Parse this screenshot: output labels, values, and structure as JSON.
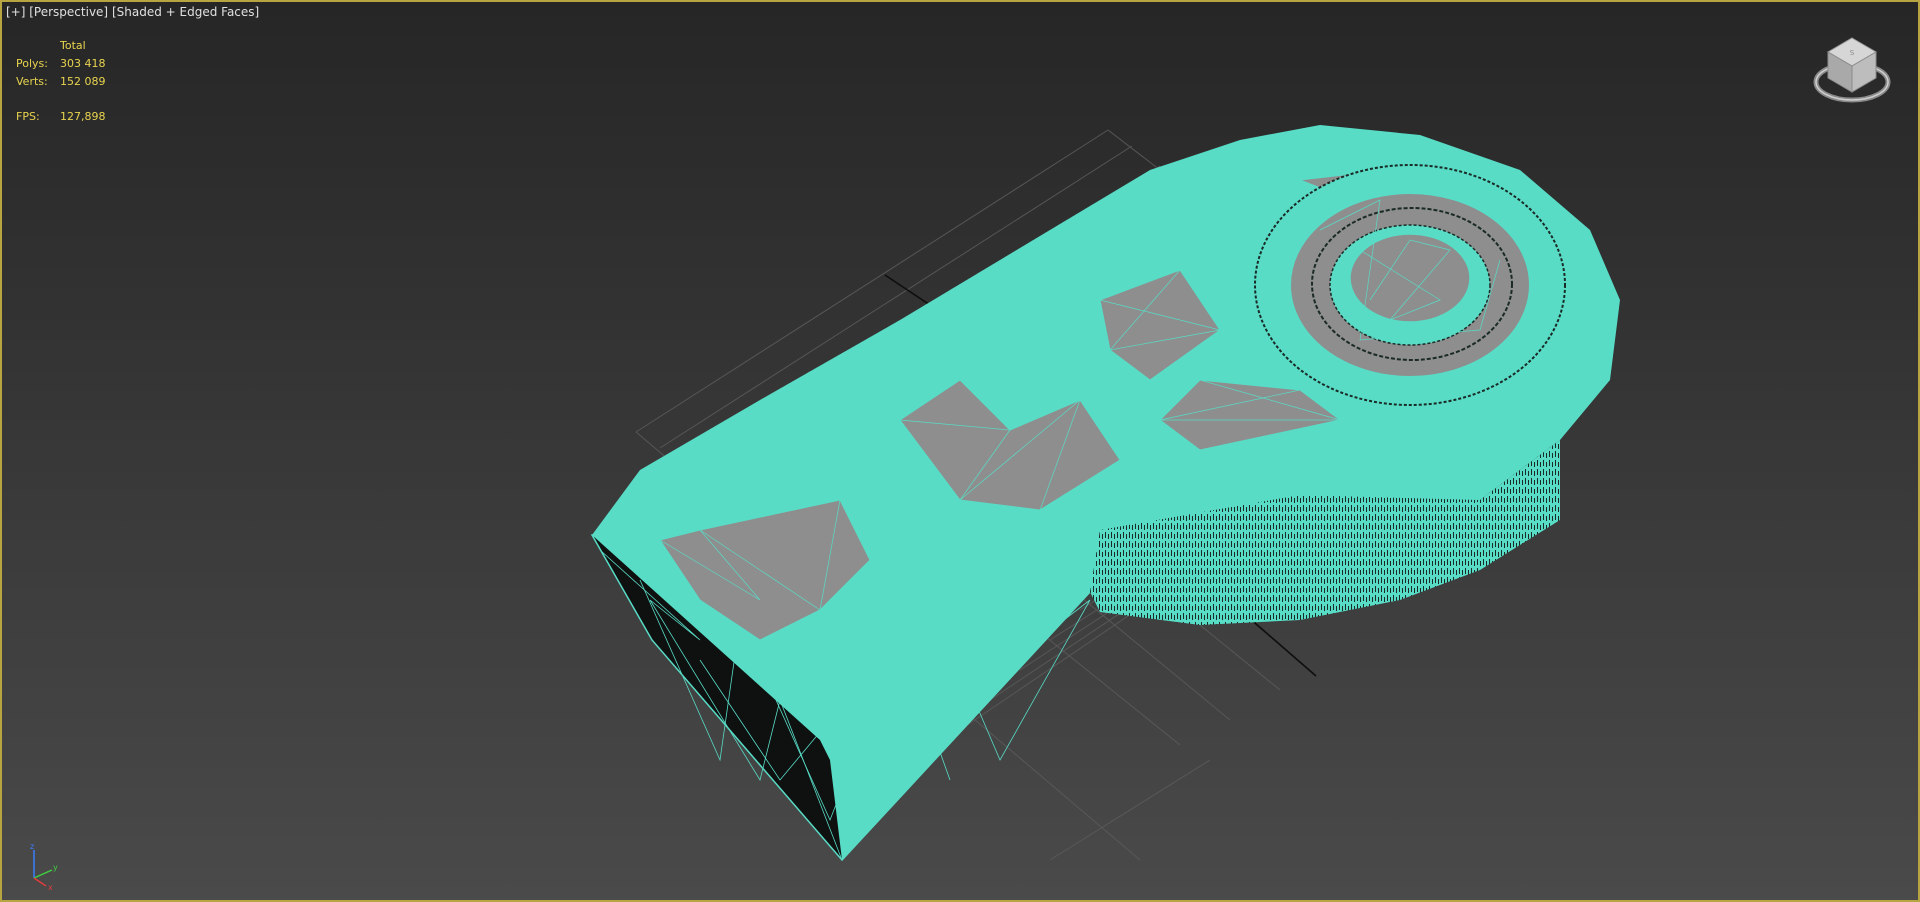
{
  "viewport": {
    "menu_label": "[+]",
    "view_label": "[Perspective]",
    "shading_label": "[Shaded + Edged Faces]"
  },
  "stats": {
    "header": "Total",
    "polys_label": "Polys:",
    "polys_value": "303 418",
    "verts_label": "Verts:",
    "verts_value": "152 089",
    "fps_label": "FPS:",
    "fps_value": "127,898"
  },
  "axis": {
    "x": "x",
    "y": "y",
    "z": "z"
  },
  "colors": {
    "mesh": "#58dcc6",
    "mesh_dark": "#0f1110",
    "mesh_gray": "#8e8e8e",
    "frame": "#b6a540",
    "stats_text": "#e8d44e"
  },
  "icons": {
    "viewcube": "viewcube-icon",
    "axis": "axis-tripod-icon"
  }
}
